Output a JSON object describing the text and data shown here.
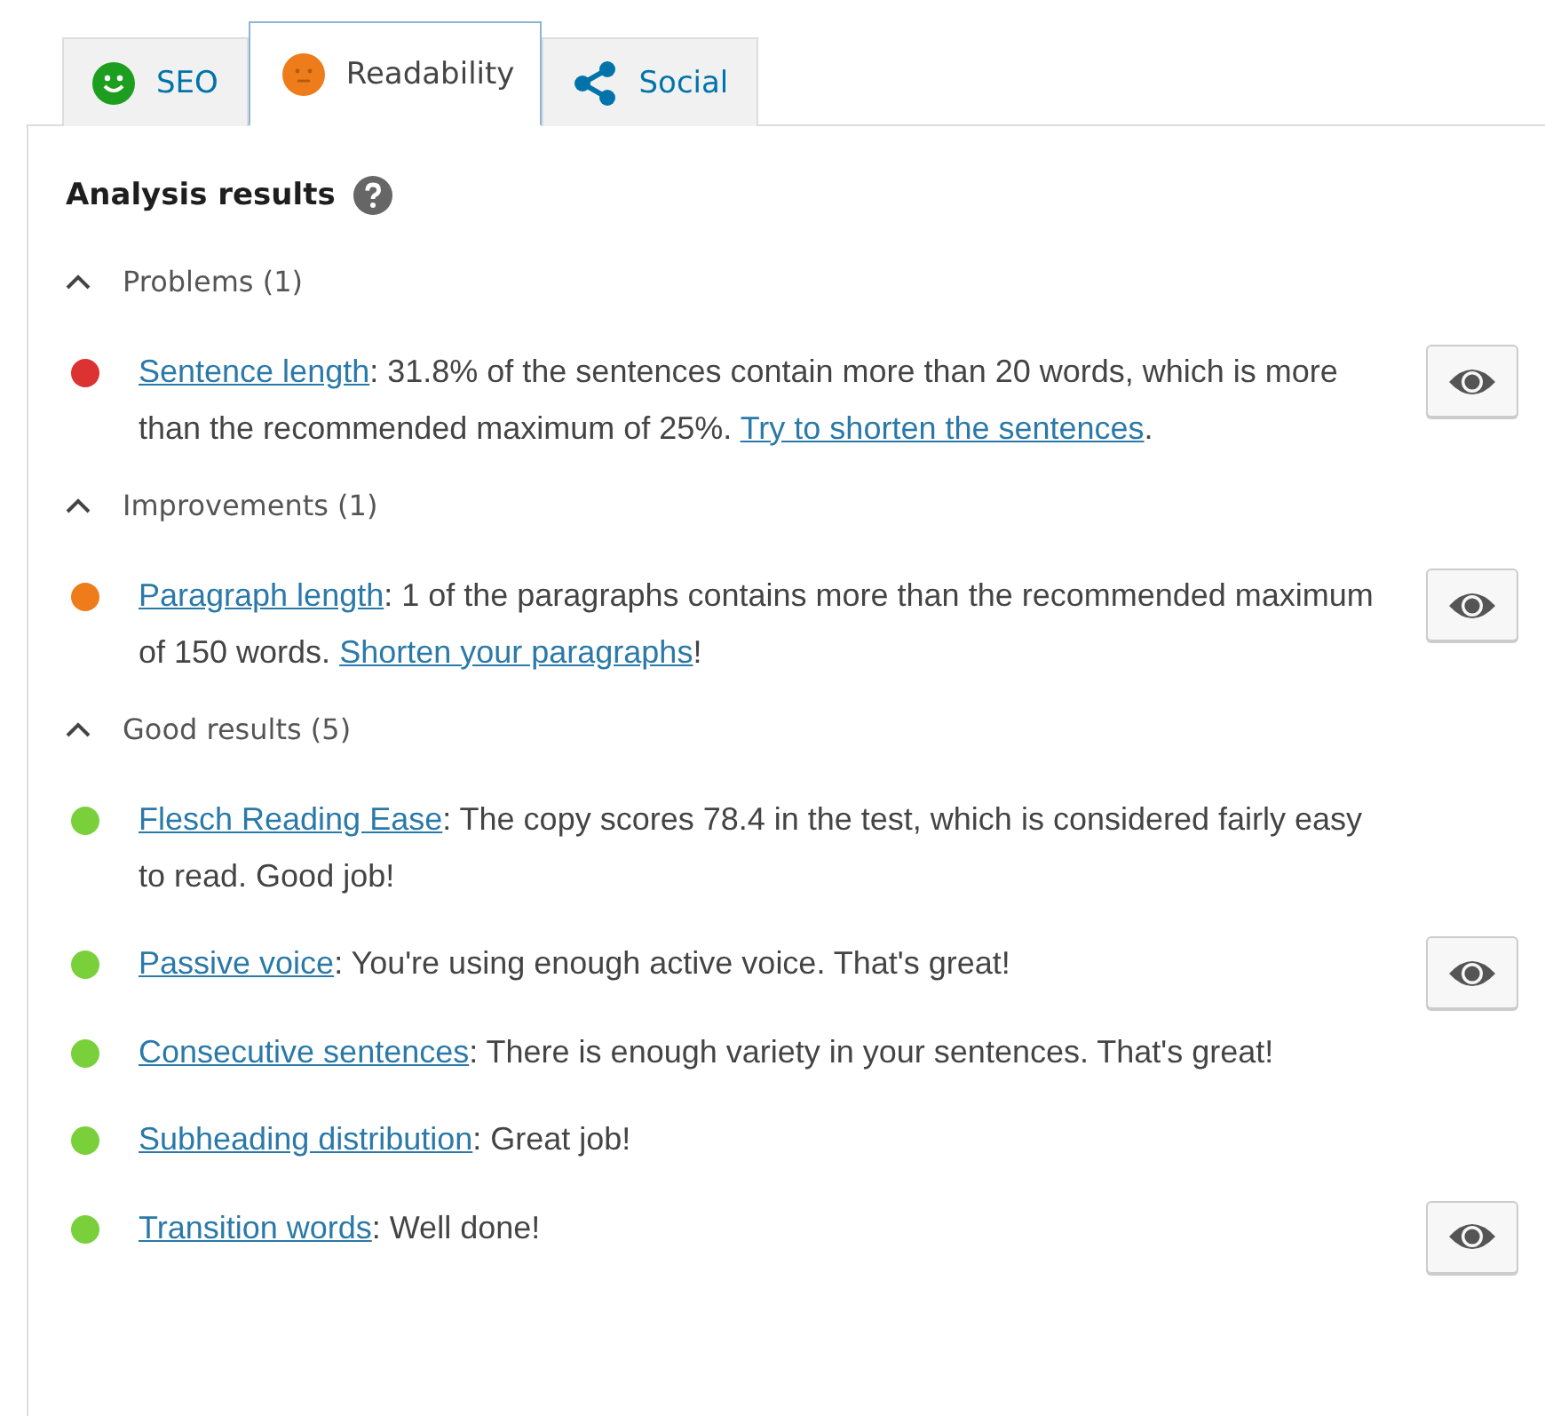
{
  "tabs": [
    {
      "label": "SEO",
      "kind": "smile",
      "selected": false
    },
    {
      "label": "Readability",
      "kind": "neutral",
      "selected": true
    },
    {
      "label": "Social",
      "kind": "share",
      "selected": false
    }
  ],
  "heading": "Analysis results",
  "sections": [
    {
      "title": "Problems (1)",
      "expanded": true,
      "results": [
        {
          "color": "#dc3232",
          "marker": true,
          "segments": [
            {
              "kind": "link",
              "text": "Sentence length"
            },
            {
              "kind": "text",
              "text": ": 31.8% of the sentences contain more than 20 words, which is more than the recommended maximum of 25%. "
            },
            {
              "kind": "link",
              "text": "Try to shorten the sentences"
            },
            {
              "kind": "text",
              "text": "."
            }
          ]
        }
      ]
    },
    {
      "title": "Improvements (1)",
      "expanded": true,
      "results": [
        {
          "color": "#ee7c1b",
          "marker": true,
          "segments": [
            {
              "kind": "link",
              "text": "Paragraph length"
            },
            {
              "kind": "text",
              "text": ": 1 of the paragraphs contains more than the recommended maximum of 150 words. "
            },
            {
              "kind": "link",
              "text": "Shorten your paragraphs"
            },
            {
              "kind": "text",
              "text": "!"
            }
          ]
        }
      ]
    },
    {
      "title": "Good results (5)",
      "expanded": true,
      "results": [
        {
          "color": "#7ad03a",
          "marker": false,
          "segments": [
            {
              "kind": "link",
              "text": "Flesch Reading Ease"
            },
            {
              "kind": "text",
              "text": ": The copy scores 78.4 in the test, which is considered fairly easy to read. Good job!"
            }
          ]
        },
        {
          "color": "#7ad03a",
          "marker": true,
          "segments": [
            {
              "kind": "link",
              "text": "Passive voice"
            },
            {
              "kind": "text",
              "text": ": You're using enough active voice. That's great!"
            }
          ]
        },
        {
          "color": "#7ad03a",
          "marker": false,
          "segments": [
            {
              "kind": "link",
              "text": "Consecutive sentences"
            },
            {
              "kind": "text",
              "text": ": There is enough variety in your sentences. That's great!"
            }
          ]
        },
        {
          "color": "#7ad03a",
          "marker": false,
          "segments": [
            {
              "kind": "link",
              "text": "Subheading distribution"
            },
            {
              "kind": "text",
              "text": ": Great job!"
            }
          ]
        },
        {
          "color": "#7ad03a",
          "marker": true,
          "segments": [
            {
              "kind": "link",
              "text": "Transition words"
            },
            {
              "kind": "text",
              "text": ": Well done!"
            }
          ]
        }
      ]
    }
  ]
}
